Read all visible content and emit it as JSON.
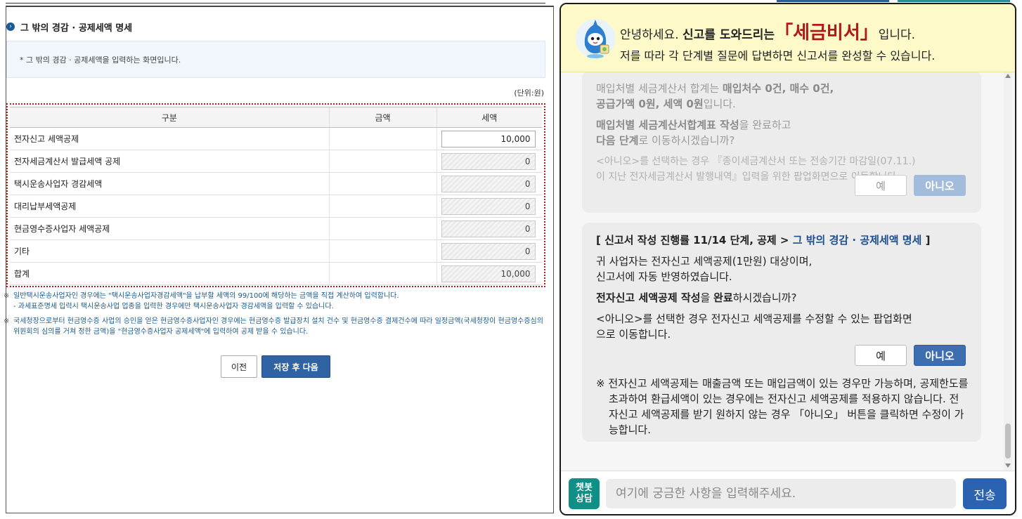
{
  "form": {
    "section_title": "그 밖의 경감 · 공제세액 명세",
    "info_text": "* 그 밖의 경감 · 공제세액을 입력하는 화면입니다.",
    "unit": "(단위:원)",
    "columns": [
      "구분",
      "금액",
      "세액"
    ],
    "rows": [
      {
        "label": "전자신고 세액공제",
        "amount": "",
        "tax": "10,000",
        "editable": true
      },
      {
        "label": "전자세금계산서 발급세액 공제",
        "amount": "",
        "tax": "0",
        "editable": false
      },
      {
        "label": "택시운송사업자 경감세액",
        "amount": "",
        "tax": "0",
        "editable": false
      },
      {
        "label": "대리납부세액공제",
        "amount": "",
        "tax": "0",
        "editable": false
      },
      {
        "label": "현금영수증사업자 세액공제",
        "amount": "",
        "tax": "0",
        "editable": false
      },
      {
        "label": "기타",
        "amount": "",
        "tax": "0",
        "editable": false
      },
      {
        "label": "합계",
        "amount": "",
        "tax": "10,000",
        "editable": false
      }
    ],
    "note_mark": "※",
    "note1": "일반택시운송사업자인 경우에는 \"택시운송사업자경감세액\"을 납부할 세액의 99/100에 해당하는 금액을 직접 계산하여 입력합니다.",
    "note1_sub": "- 과세표준명세 입력시 택시운송사업 업종을 입력한 경우에만 택시운송사업자 경감세액을 입력할 수 있습니다.",
    "note2": "국세청장으로부터 현금영수증 사업의 승인을 얻은 현금영수증사업자인 경우에는 현금영수증 발급장치 설치 건수 및 현금영수증 결제건수에 따라 일정금액(국세청장이 현금영수증심의위원회의 심의를 거쳐 정한 금액)을 \"현금영수증사업자 공제세액\"에 입력하여 공제 받을 수 있습니다.",
    "btn_prev": "이전",
    "btn_next": "저장 후 다음"
  },
  "chat": {
    "greet_pre": "안녕하세요. ",
    "greet_bold": "신고를 도와드리는",
    "brand": "「세금비서」",
    "greet_post": "입니다.",
    "greet_line2": "저를 따라 각 단계별 질문에 답변하면 신고서를 완성할 수 있습니다.",
    "old_msg": {
      "line1_pre": "매입처별 세금계산서 합계는 ",
      "line1_bold": "매입처수 0건, 매수 0건,",
      "line2_bold": "공급가액 0원, 세액 0원",
      "line2_post": "입니다.",
      "line3_bold": "매입처별 세금계산서합계표 작성",
      "line3_post": "을 완료하고",
      "line4_bold": "다음 단계",
      "line4_post": "로 이동하시겠습니까?",
      "line5": "<아니오>를 선택하는 경우 『종이세금계산서 또는 전송기간 마감일(07.11.)",
      "line6": "이 지난 전자세금계산서 발행내역』입력을 위한 팝업화면으로 이동합니다.",
      "yes": "예",
      "no": "아니오"
    },
    "cur_msg": {
      "progress_pre": "[ 신고서 작성 진행률 11/14 단계, 공제 > ",
      "progress_link": "그 밖의 경감 · 공제세액 명세",
      "progress_post": " ]",
      "line1": "귀 사업자는 전자신고 세액공제(1만원) 대상이며,",
      "line2": "신고서에 자동 반영하였습니다.",
      "q_bold": "전자신고 세액공제 작성",
      "q_mid": "을 ",
      "q_bold2": "완료",
      "q_post": "하시겠습니까?",
      "line4": "<아니오>를 선택한 경우 전자신고 세액공제를 수정할 수 있는 팝업화면",
      "line5": "으로 이동합니다.",
      "yes": "예",
      "no": "아니오",
      "note": "※ 전자신고 세액공제는 매출금액 또는 매입금액이 있는 경우만 가능하며, 공제한도를 초과하여 환급세액이 있는 경우에는 전자신고 세액공제를 적용하지 않습니다. 전자신고 세액공제를 받기 원하지 않는 경우 「아니오」 버튼을 클릭하면 수정이 가능합니다."
    },
    "chatbot_label": "챗봇\n상담",
    "input_placeholder": "여기에 궁금한 사항을 입력해주세요.",
    "send": "전송"
  },
  "colors": {
    "accent": "#2f63a3",
    "brand_red": "#b01919",
    "header_bg": "#fdf9c8",
    "dotted_border": "#b21f1f"
  }
}
